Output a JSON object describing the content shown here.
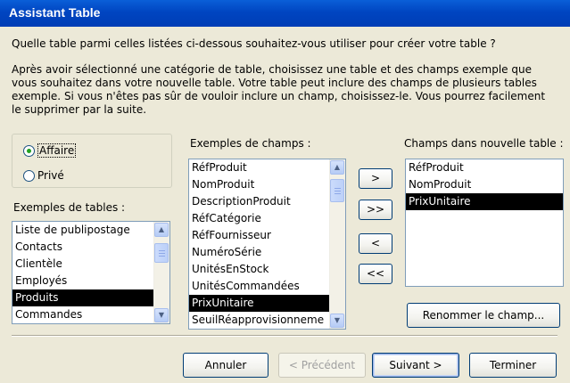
{
  "window": {
    "title": "Assistant Table"
  },
  "question": "Quelle table parmi celles listées ci-dessous souhaitez-vous utiliser pour créer votre table ?",
  "instructions": "Après avoir sélectionné une catégorie de table, choisissez une table et des champs exemple que vous souhaitez dans votre nouvelle table. Votre table peut inclure des champs de plusieurs tables exemple. Si vous n'êtes pas sûr de vouloir inclure un champ, choisissez-le. Vous pourrez facilement le supprimer par la suite.",
  "category": {
    "options": [
      {
        "label": "Affaire",
        "selected": true
      },
      {
        "label": "Privé",
        "selected": false
      }
    ]
  },
  "tables": {
    "label": "Exemples de tables :",
    "items": [
      "Liste de publipostage",
      "Contacts",
      "Clientèle",
      "Employés",
      "Produits",
      "Commandes"
    ],
    "selected": "Produits"
  },
  "fields": {
    "label": "Exemples de champs :",
    "items": [
      "RéfProduit",
      "NomProduit",
      "DescriptionProduit",
      "RéfCatégorie",
      "RéfFournisseur",
      "NuméroSérie",
      "UnitésEnStock",
      "UnitésCommandées",
      "PrixUnitaire",
      "SeuilRéapprovisionneme"
    ],
    "selected": "PrixUnitaire"
  },
  "new_fields": {
    "label": "Champs dans nouvelle table :",
    "items": [
      "RéfProduit",
      "NomProduit",
      "PrixUnitaire"
    ],
    "selected": "PrixUnitaire"
  },
  "move_buttons": {
    "add": ">",
    "add_all": ">>",
    "remove": "<",
    "remove_all": "<<"
  },
  "rename_button": "Renommer le champ...",
  "footer": {
    "cancel": "Annuler",
    "previous": "< Précédent",
    "next": "Suivant >",
    "finish": "Terminer"
  },
  "colors": {
    "title_bar": "#0045C1",
    "dialog_bg": "#ECE9D8",
    "selection": "#000000",
    "radio_dot": "#21A121"
  },
  "icons": {
    "scroll_up": "scroll-up-arrow-icon",
    "scroll_down": "scroll-down-arrow-icon"
  }
}
